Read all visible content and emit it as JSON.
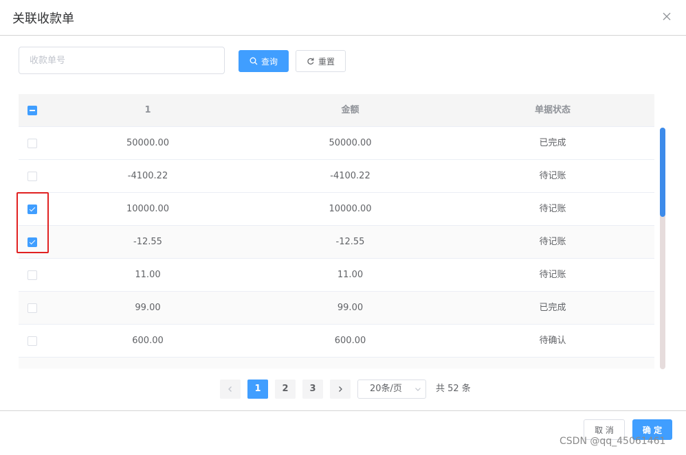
{
  "dialog": {
    "title": "关联收款单",
    "close_icon": "close-icon"
  },
  "search": {
    "placeholder": "收款单号",
    "value": "",
    "query_label": "查询",
    "reset_label": "重置"
  },
  "table": {
    "columns": [
      "1",
      "金额",
      "单据状态"
    ],
    "rows": [
      {
        "c1": "50000.00",
        "c2": "50000.00",
        "status": "已完成",
        "checked": false
      },
      {
        "c1": "-4100.22",
        "c2": "-4100.22",
        "status": "待记账",
        "checked": false
      },
      {
        "c1": "10000.00",
        "c2": "10000.00",
        "status": "待记账",
        "checked": true
      },
      {
        "c1": "-12.55",
        "c2": "-12.55",
        "status": "待记账",
        "checked": true
      },
      {
        "c1": "11.00",
        "c2": "11.00",
        "status": "待记账",
        "checked": false
      },
      {
        "c1": "99.00",
        "c2": "99.00",
        "status": "已完成",
        "checked": false
      },
      {
        "c1": "600.00",
        "c2": "600.00",
        "status": "待确认",
        "checked": false
      }
    ]
  },
  "pagination": {
    "pages": [
      "1",
      "2",
      "3"
    ],
    "current": "1",
    "page_size": "20条/页",
    "total": "共 52 条"
  },
  "footer": {
    "cancel_label": "取 消",
    "ok_label": "确 定"
  },
  "watermark": "CSDN @qq_45061461",
  "colors": {
    "primary": "#409eff",
    "highlight": "#e02020"
  }
}
